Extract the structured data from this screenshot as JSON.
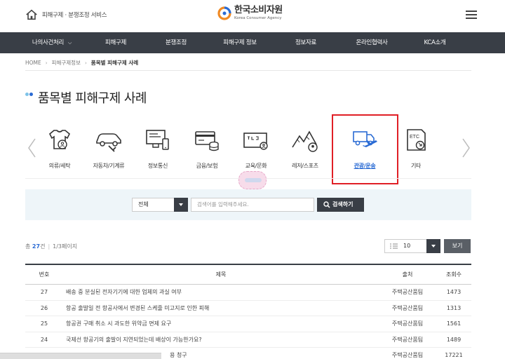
{
  "header": {
    "home_text": "피해구제 · 분쟁조정 서비스",
    "logo_ko": "한국소비자원",
    "logo_en": "Korea Consumer Agency",
    "brand_colors": {
      "orange": "#f08a24",
      "blue": "#2a6bd4"
    }
  },
  "nav": {
    "items": [
      {
        "label": "나의사건처리",
        "has_dropdown": true
      },
      {
        "label": "피해구제"
      },
      {
        "label": "분쟁조정"
      },
      {
        "label": "피해구제 정보"
      },
      {
        "label": "정보자료"
      },
      {
        "label": "온라인협력사"
      },
      {
        "label": "KCA소개"
      }
    ],
    "bg": "#393e46"
  },
  "breadcrumb": {
    "home": "HOME",
    "level1": "피해구제정보",
    "current": "품목별 피해구제 사례"
  },
  "page_title": "품목별 피해구제 사례",
  "categories": [
    {
      "label": "의류/세탁",
      "icon": "clothing-icon"
    },
    {
      "label": "자동차/기계류",
      "icon": "car-icon"
    },
    {
      "label": "정보통신",
      "icon": "computer-phone-icon"
    },
    {
      "label": "금융/보험",
      "icon": "card-coins-icon"
    },
    {
      "label": "교육/문화",
      "icon": "blackboard-icon"
    },
    {
      "label": "레저/스포츠",
      "icon": "mountain-ball-icon"
    },
    {
      "label": "관광/운송",
      "icon": "truck-plane-icon",
      "active": true
    },
    {
      "label": "기타",
      "icon": "etc-icon"
    }
  ],
  "search": {
    "select_value": "전체",
    "placeholder": "검색어를 입력해주세요.",
    "button_label": "검색하기"
  },
  "summary": {
    "prefix": "총",
    "count": "27",
    "suffix": "건",
    "page_info": "1/3페이지"
  },
  "page_size": {
    "value": "10",
    "button_label": "보기"
  },
  "table": {
    "headers": {
      "no": "번호",
      "title": "제목",
      "source": "출처",
      "views": "조회수"
    },
    "rows": [
      {
        "no": "27",
        "title": "배송 중 분실된 전자기기에 대한 업체의 과실 여부",
        "source": "주택공산품팀",
        "views": "1473"
      },
      {
        "no": "26",
        "title": "항공 출발일 전 항공사에서 변경된 스케줄 미고지로 인한 피해",
        "source": "주택공산품팀",
        "views": "1313"
      },
      {
        "no": "25",
        "title": "항공권 구매 취소 시 과도한 위약금 면제 요구",
        "source": "주택공산품팀",
        "views": "1561"
      },
      {
        "no": "24",
        "title": "국제선 항공기의 출발이 지연되었는데 배상이 가능한가요?",
        "source": "주택공산품팀",
        "views": "1489"
      },
      {
        "no": "",
        "title": "용 청구",
        "source": "주택공산품팀",
        "views": "17221"
      }
    ]
  }
}
